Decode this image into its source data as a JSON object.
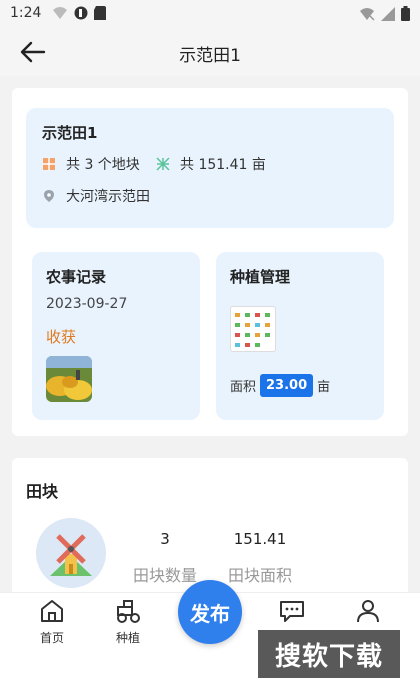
{
  "status_bar": {
    "time": "1:24"
  },
  "header": {
    "title": "示范田1"
  },
  "field": {
    "name": "示范田1",
    "plot_count": "共 3 个地块",
    "area_total": "共 151.41 亩",
    "location": "大河湾示范田"
  },
  "farm_record": {
    "title": "农事记录",
    "date": "2023-09-27",
    "status": "收获"
  },
  "planting": {
    "title": "种植管理",
    "area_label": "面积",
    "area_value": "23.00",
    "area_unit": "亩"
  },
  "plots_section": {
    "title": "田块",
    "count_value": "3",
    "count_label": "田块数量",
    "area_value": "151.41",
    "area_label": "田块面积"
  },
  "nav": {
    "home": "首页",
    "planting": "种植",
    "publish": "发布",
    "messages": "",
    "profile": ""
  },
  "watermark": "搜软下载",
  "colors": {
    "accent": "#2f80ed",
    "harvest": "#e07a1e",
    "card_bg": "#e9f3fd"
  }
}
